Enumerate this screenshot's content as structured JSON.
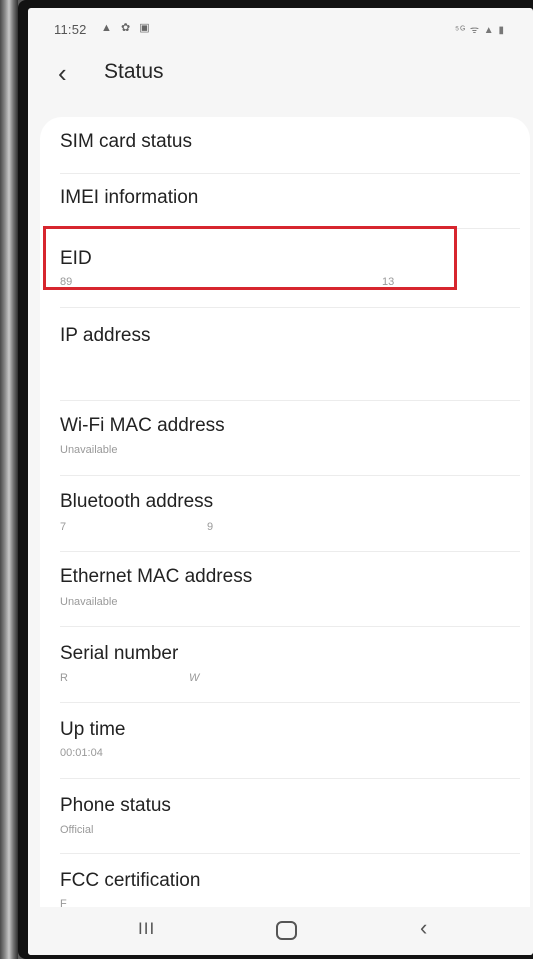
{
  "status_bar": {
    "time": "11:52",
    "left_icons": "▲ ✿ ▣",
    "right_icons": "⁵ᴳ ᯤ ▲ ▮"
  },
  "header": {
    "back_glyph": "‹",
    "title": "Status"
  },
  "items": [
    {
      "title": "SIM card status",
      "sub": ""
    },
    {
      "title": "IMEI information",
      "sub": ""
    },
    {
      "title": "EID",
      "sub": "89",
      "sub_right": "13"
    },
    {
      "title": "IP address",
      "sub": ""
    },
    {
      "title": "Wi-Fi MAC address",
      "sub": "Unavailable"
    },
    {
      "title": "Bluetooth address",
      "sub": "7",
      "sub_right": "9"
    },
    {
      "title": "Ethernet MAC address",
      "sub": "Unavailable"
    },
    {
      "title": "Serial number",
      "sub": "R",
      "sub_right": "W"
    },
    {
      "title": "Up time",
      "sub": "00:01:04"
    },
    {
      "title": "Phone status",
      "sub": "Official"
    },
    {
      "title": "FCC certification",
      "sub": "F"
    }
  ],
  "nav": {
    "recent_glyph": "III",
    "back_glyph": "‹"
  },
  "colors": {
    "highlight": "#d7262e",
    "card": "#ffffff",
    "background": "#f6f6f6"
  }
}
